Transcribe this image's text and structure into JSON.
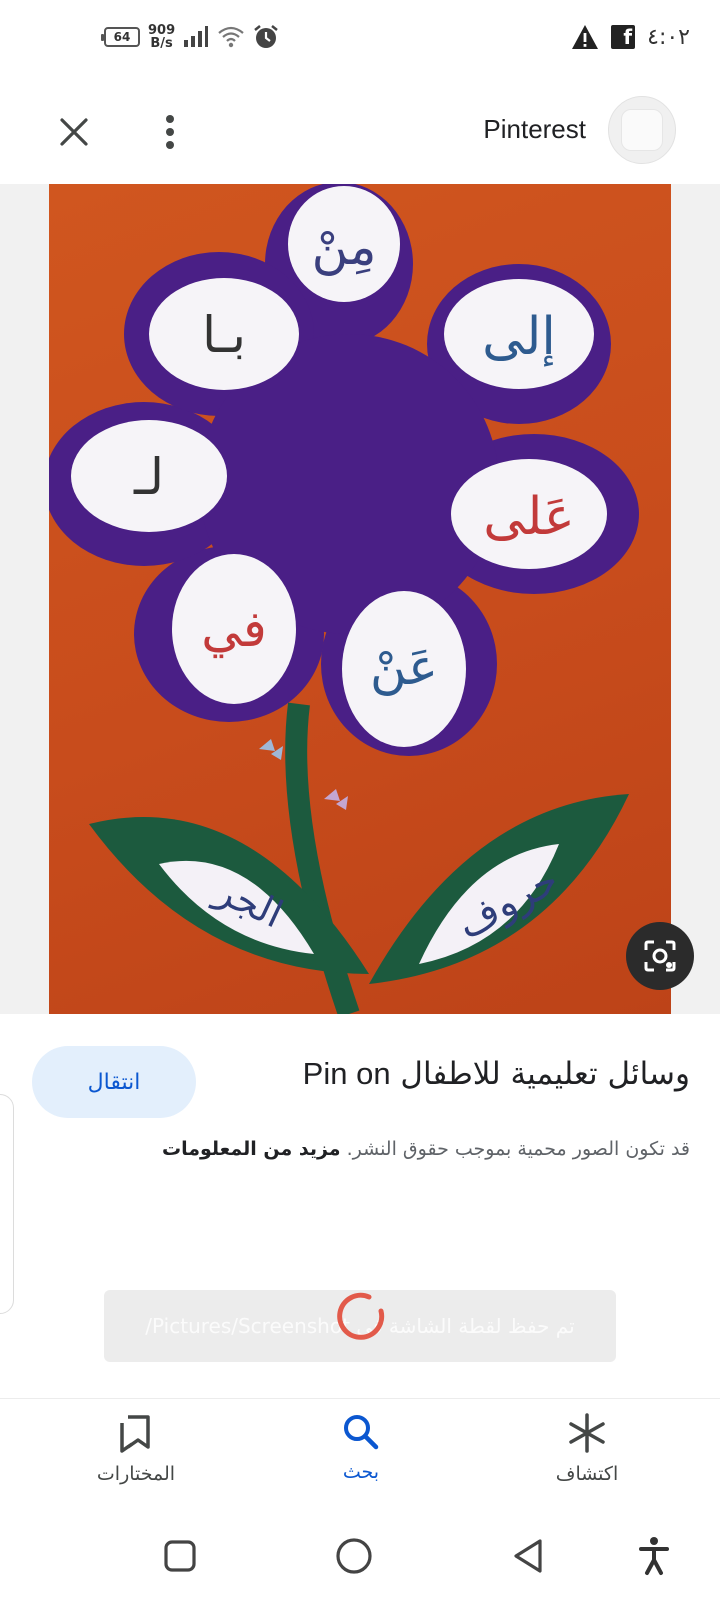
{
  "status_bar": {
    "battery": "64",
    "net_speed_value": "909",
    "net_speed_unit": "B/s",
    "time": "٤:٠٢",
    "icons": [
      "signal-icon",
      "wifi-icon",
      "alarm-icon",
      "warning-icon",
      "facebook-icon"
    ]
  },
  "top_bar": {
    "source_name": "Pinterest",
    "icons": [
      "close-icon",
      "more-vert-icon"
    ]
  },
  "image": {
    "petal_words": [
      "مِنْ",
      "إلى",
      "عَلى",
      "عَنْ",
      "في",
      "لـ",
      "بـا"
    ],
    "leaf_words": [
      "حروف",
      "الجر"
    ],
    "colors": {
      "background": "#c94e1d",
      "flower": "#4a1f86",
      "leaf": "#1c5a3e"
    }
  },
  "info": {
    "pin_title_en": "Pin on",
    "pin_title_ar": "وسائل تعليمية للاطفال",
    "visit_label": "انتقال",
    "copyright_text": "قد تكون الصور محمية بموجب حقوق النشر.",
    "more_info_label": "مزيد من المعلومات"
  },
  "toast": {
    "text": "تم حفظ لقطة الشاشة في Pictures/Screenshot/"
  },
  "bottom_nav": {
    "saved_label": "المختارات",
    "search_label": "بحث",
    "discover_label": "اكتشاف",
    "active": "search",
    "accent": "#0b57d0"
  },
  "system_nav": {
    "icons": [
      "recents-icon",
      "home-icon",
      "back-icon",
      "accessibility-icon"
    ]
  }
}
